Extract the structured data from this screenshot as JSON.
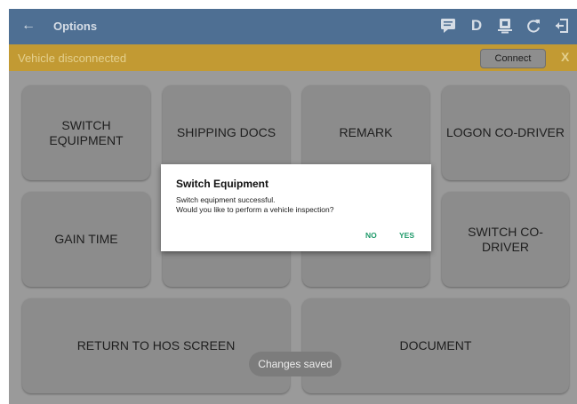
{
  "appbar": {
    "back_icon": "arrow-left-icon",
    "title": "Options",
    "icon_d": "D"
  },
  "banner": {
    "message": "Vehicle disconnected",
    "connect_label": "Connect",
    "close_label": "X"
  },
  "tiles": [
    {
      "label": "SWITCH EQUIPMENT"
    },
    {
      "label": "SHIPPING DOCS"
    },
    {
      "label": "REMARK"
    },
    {
      "label": "LOGON CO-DRIVER"
    },
    {
      "label": "GAIN TIME"
    },
    {
      "label": "SWITCH CO-DRIVER"
    },
    {
      "label": "RETURN TO HOS SCREEN"
    },
    {
      "label": "DOCUMENT"
    }
  ],
  "dialog": {
    "title": "Switch Equipment",
    "message_line1": "Switch equipment successful.",
    "message_line2": "Would you like to perform a vehicle inspection?",
    "no_label": "NO",
    "yes_label": "YES"
  },
  "toast": {
    "text": "Changes saved"
  },
  "colors": {
    "appbar": "#4e6f93",
    "banner": "#c29a33",
    "accent": "#1f9a6a"
  }
}
